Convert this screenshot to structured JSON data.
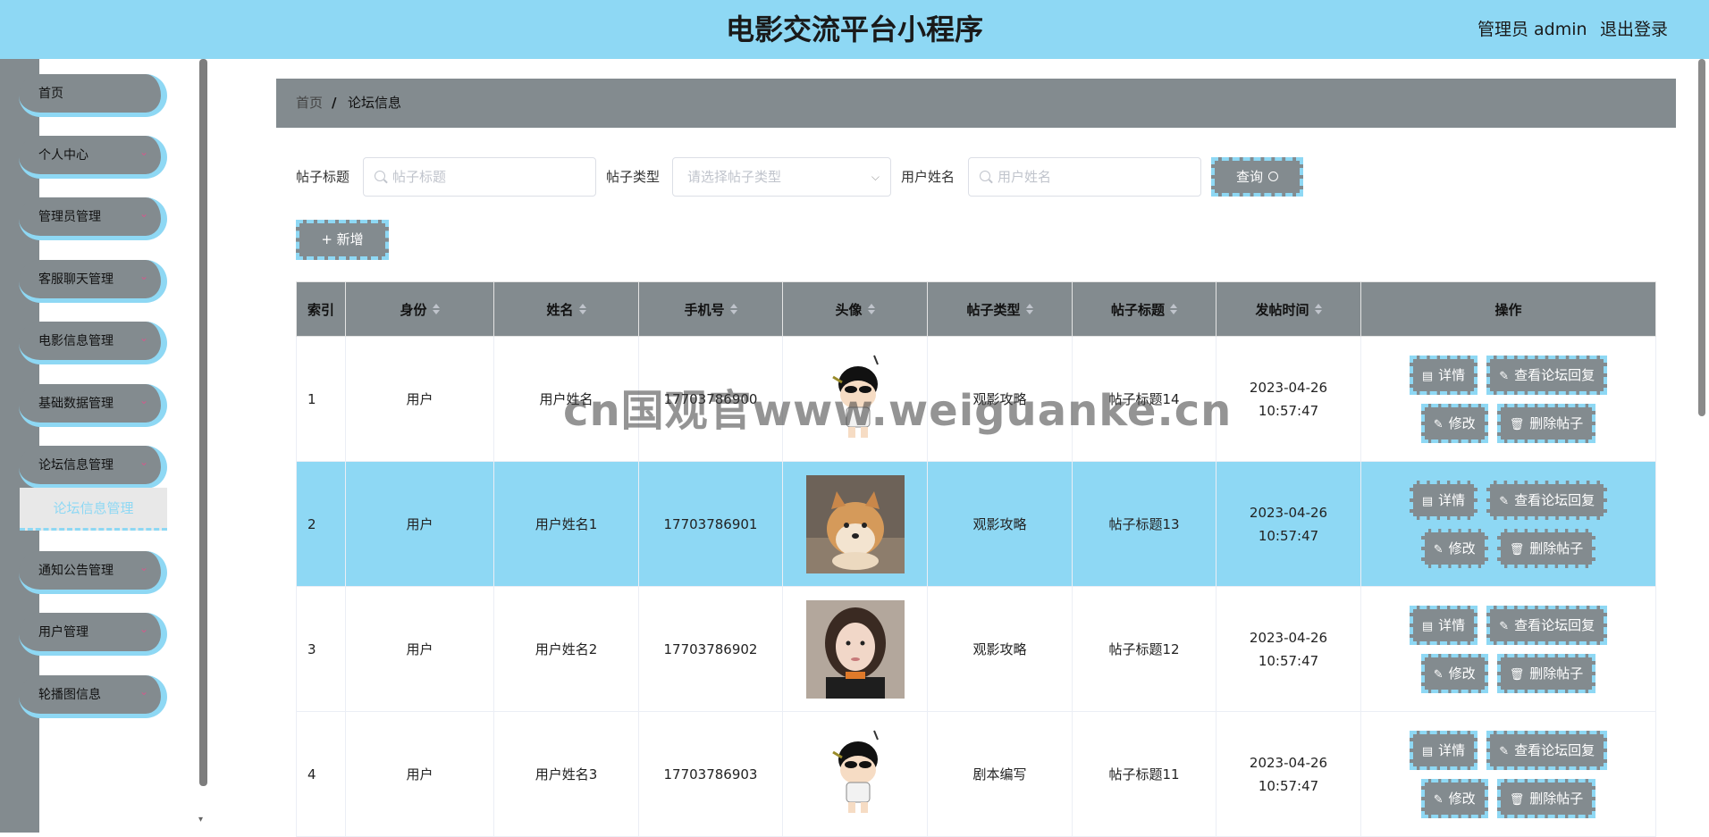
{
  "header": {
    "title": "电影交流平台小程序",
    "admin": "管理员 admin",
    "logout": "退出登录"
  },
  "sidebar": {
    "items": [
      {
        "label": "首页"
      },
      {
        "label": "个人中心"
      },
      {
        "label": "管理员管理"
      },
      {
        "label": "客服聊天管理"
      },
      {
        "label": "电影信息管理"
      },
      {
        "label": "基础数据管理"
      },
      {
        "label": "论坛信息管理"
      },
      {
        "label": "通知公告管理"
      },
      {
        "label": "用户管理"
      },
      {
        "label": "轮播图信息"
      }
    ],
    "submenu": {
      "label": "论坛信息管理"
    }
  },
  "breadcrumb": {
    "home": "首页",
    "separator": "/",
    "current": "论坛信息"
  },
  "search": {
    "title_label": "帖子标题",
    "title_placeholder": "帖子标题",
    "type_label": "帖子类型",
    "type_placeholder": "请选择帖子类型",
    "user_label": "用户姓名",
    "user_placeholder": "用户姓名",
    "query_button": "查询",
    "add_button": "+ 新增"
  },
  "table": {
    "columns": [
      "索引",
      "身份",
      "姓名",
      "手机号",
      "头像",
      "帖子类型",
      "帖子标题",
      "发帖时间",
      "操作"
    ],
    "rows": [
      {
        "index": "1",
        "role": "用户",
        "name": "用户姓名",
        "phone": "17703786900",
        "avatar": "cartoon-avatar",
        "type": "观影攻略",
        "title": "帖子标题14",
        "time": "2023-04-26 10:57:47"
      },
      {
        "index": "2",
        "role": "用户",
        "name": "用户姓名1",
        "phone": "17703786901",
        "avatar": "dog-photo",
        "type": "观影攻略",
        "title": "帖子标题13",
        "time": "2023-04-26 10:57:47"
      },
      {
        "index": "3",
        "role": "用户",
        "name": "用户姓名2",
        "phone": "17703786902",
        "avatar": "woman-photo",
        "type": "观影攻略",
        "title": "帖子标题12",
        "time": "2023-04-26 10:57:47"
      },
      {
        "index": "4",
        "role": "用户",
        "name": "用户姓名3",
        "phone": "17703786903",
        "avatar": "cartoon-avatar",
        "type": "剧本编写",
        "title": "帖子标题11",
        "time": "2023-04-26 10:57:47"
      }
    ],
    "actions": {
      "detail": "详情",
      "view_replies": "查看论坛回复",
      "edit": "修改",
      "delete": "删除帖子"
    }
  },
  "watermark": "cn国观官www.weiguanke.cn",
  "colors": {
    "header": "#8ed8f4",
    "sidebar": "#838b8f",
    "button": "#838b8f",
    "accent": "#8ed8f4",
    "highlight_row": "#8ed8f4"
  }
}
